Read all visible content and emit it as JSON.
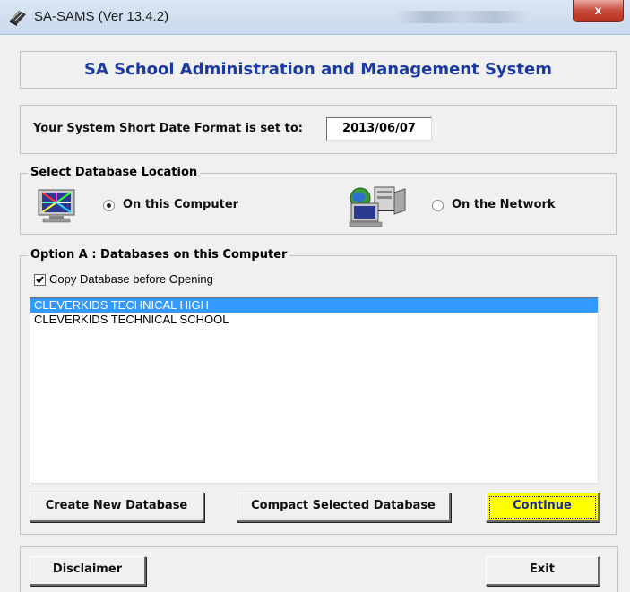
{
  "window": {
    "title": "SA-SAMS (Ver 13.4.2)",
    "close_glyph": "x"
  },
  "header": {
    "title": "SA School Administration and Management System"
  },
  "date_format": {
    "label": "Your System Short Date Format is set to:",
    "value": "2013/06/07"
  },
  "location": {
    "legend": "Select Database Location",
    "local_label": "On this Computer",
    "network_label": "On the Network",
    "selected": "local",
    "local_icon": "computer-monitor-icon",
    "network_icon": "network-computer-icon"
  },
  "option_a": {
    "legend": "Option A : Databases on this Computer",
    "copy_label": "Copy Database before Opening",
    "copy_checked": true,
    "databases": [
      "CLEVERKIDS TECHNICAL HIGH",
      "CLEVERKIDS TECHNICAL SCHOOL"
    ],
    "selected_index": 0
  },
  "buttons": {
    "create": "Create New Database",
    "compact": "Compact Selected Database",
    "continue": "Continue",
    "disclaimer": "Disclaimer",
    "exit": "Exit"
  },
  "colors": {
    "header_text": "#1b3a9e",
    "selection": "#3399ff",
    "continue_bg": "#ffff00"
  }
}
